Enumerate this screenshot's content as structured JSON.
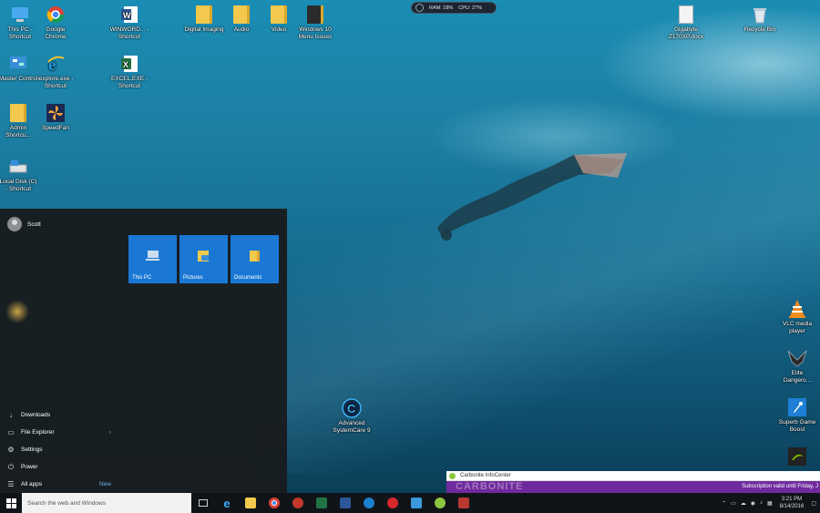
{
  "monitor": {
    "ram": "RAM: 18%",
    "cpu": "CPU: 27%"
  },
  "desktop_icons": [
    {
      "label": "This PC - Shortcut",
      "icon": "this-pc-icon"
    },
    {
      "label": "Google Chrome",
      "icon": "chrome-icon"
    },
    {
      "label": "WINWORD... - Shortcut",
      "icon": "word-icon"
    },
    {
      "label": "Digital Imaging",
      "icon": "folder-icon"
    },
    {
      "label": "Audio",
      "icon": "folder-icon"
    },
    {
      "label": "Video",
      "icon": "folder-icon"
    },
    {
      "label": "Windows 10 Menu Issues",
      "icon": "folder-icon"
    },
    {
      "label": "Gigabyte Z170XP.docx",
      "icon": "document-icon"
    },
    {
      "label": "Recycle Bin",
      "icon": "recycle-bin-icon"
    },
    {
      "label": "Master Control",
      "icon": "control-panel-icon"
    },
    {
      "label": "iexplore.exe - Shortcut",
      "icon": "internet-explorer-icon"
    },
    {
      "label": "EXCEL.EXE - Shortcut",
      "icon": "excel-icon"
    },
    {
      "label": "Admin Shortcu...",
      "icon": "folder-icon"
    },
    {
      "label": "SpeedFan",
      "icon": "speedfan-icon"
    },
    {
      "label": "Local Disk (C) - Shortcut",
      "icon": "drive-icon"
    },
    {
      "label": "VLC media player",
      "icon": "vlc-icon"
    },
    {
      "label": "Elite Dangero...",
      "icon": "elite-dangerous-icon"
    },
    {
      "label": "Superb Game Boost",
      "icon": "game-boost-icon"
    },
    {
      "label": "Advanced SystemCare 9",
      "icon": "systemcare-icon"
    }
  ],
  "start_menu": {
    "user": "Scott",
    "tiles": [
      {
        "label": "This PC"
      },
      {
        "label": "Pictures"
      },
      {
        "label": "Documents"
      }
    ],
    "items": [
      {
        "label": "Downloads",
        "icon": "download-icon"
      },
      {
        "label": "File Explorer",
        "icon": "file-explorer-icon"
      },
      {
        "label": "Settings",
        "icon": "gear-icon"
      },
      {
        "label": "Power",
        "icon": "power-icon"
      },
      {
        "label": "All apps",
        "icon": "all-apps-icon",
        "badge": "New"
      }
    ]
  },
  "carbonite": {
    "title": "Carbonite InfoCenter",
    "brand": "CARBONITE",
    "subscription": "Subscription valid until Friday, J"
  },
  "taskbar": {
    "search_placeholder": "Search the web and Windows",
    "clock_time": "3:21 PM",
    "clock_date": "8/14/2016"
  },
  "colors": {
    "tile_blue": "#1a78d4",
    "carbonite_purple": "#6f2b9e",
    "taskbar": "#101418"
  }
}
